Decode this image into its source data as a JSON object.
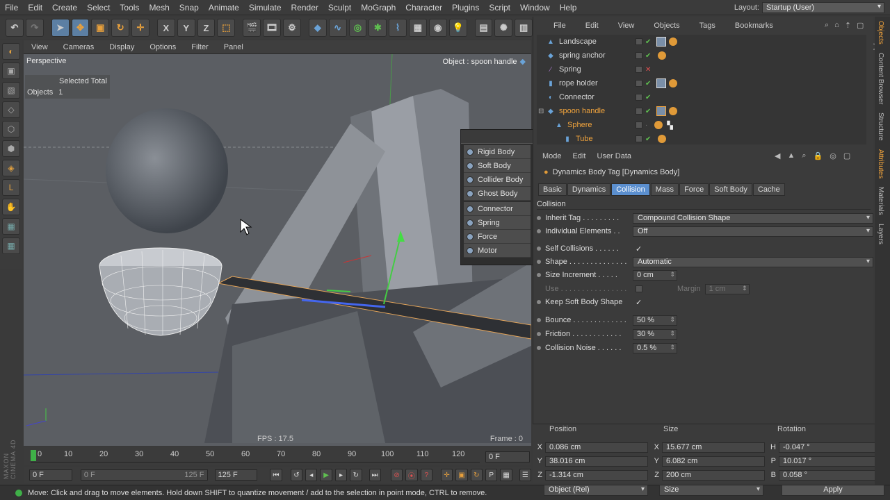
{
  "menu": [
    "File",
    "Edit",
    "Create",
    "Select",
    "Tools",
    "Mesh",
    "Snap",
    "Animate",
    "Simulate",
    "Render",
    "Sculpt",
    "MoGraph",
    "Character",
    "Plugins",
    "Script",
    "Window",
    "Help"
  ],
  "layout": {
    "label": "Layout:",
    "value": "Startup (User)"
  },
  "toolbar": {
    "x": "X",
    "y": "Y",
    "z": "Z"
  },
  "viewport": {
    "menu": [
      "View",
      "Cameras",
      "Display",
      "Options",
      "Filter",
      "Panel"
    ],
    "name": "Perspective",
    "hud_selected": "Selected Total",
    "hud_objects_label": "Objects",
    "hud_objects_value": "1",
    "object_label": "Object : spoon handle",
    "fps": "FPS : 17.5",
    "frame": "Frame : 0"
  },
  "dynamics_menu": [
    "Rigid Body",
    "Soft Body",
    "Collider Body",
    "Ghost Body",
    "Connector",
    "Spring",
    "Force",
    "Motor"
  ],
  "objects": {
    "menu": [
      "File",
      "Edit",
      "View",
      "Objects",
      "Tags",
      "Bookmarks"
    ],
    "items": [
      {
        "name": "Landscape",
        "icon": "landscape-icon"
      },
      {
        "name": "spring anchor",
        "icon": "cube-icon"
      },
      {
        "name": "Spring",
        "icon": "spring-icon"
      },
      {
        "name": "rope holder",
        "icon": "cube-icon"
      },
      {
        "name": "Connector",
        "icon": "connector-icon"
      },
      {
        "name": "spoon handle",
        "icon": "cube-icon"
      },
      {
        "name": "Sphere",
        "icon": "sphere-icon"
      },
      {
        "name": "Tube",
        "icon": "tube-icon"
      }
    ]
  },
  "attributes": {
    "menu": [
      "Mode",
      "Edit",
      "User Data"
    ],
    "title": "Dynamics Body Tag [Dynamics Body]",
    "tabs": [
      "Basic",
      "Dynamics",
      "Collision",
      "Mass",
      "Force",
      "Soft Body",
      "Cache"
    ],
    "active_tab": "Collision",
    "section": "Collision",
    "inherit_tag": {
      "label": "Inherit Tag . . . . . . . . .",
      "value": "Compound Collision Shape"
    },
    "individual": {
      "label": "Individual Elements . .",
      "value": "Off"
    },
    "self_collisions": {
      "label": "Self Collisions . . . . . .",
      "value": "✓"
    },
    "shape": {
      "label": "Shape . . . . . . . . . . . . . .",
      "value": "Automatic"
    },
    "size_increment": {
      "label": "Size Increment . . . . .",
      "value": "0 cm"
    },
    "use": {
      "label": "Use . . . . . . . . . . . . . . . .",
      "margin_label": "Margin",
      "margin_value": "1 cm"
    },
    "keep_soft": {
      "label": "Keep Soft Body Shape",
      "value": "✓"
    },
    "bounce": {
      "label": "Bounce . . . . . . . . . . . . .",
      "value": "50 %"
    },
    "friction": {
      "label": "Friction . . . . . . . . . . . .",
      "value": "30 %"
    },
    "noise": {
      "label": "Collision Noise . . . . . .",
      "value": "0.5 %"
    }
  },
  "coords": {
    "headers": [
      "Position",
      "Size",
      "Rotation"
    ],
    "rows": [
      {
        "a": "X",
        "pos": "0.086 cm",
        "b": "X",
        "size": "15.677 cm",
        "c": "H",
        "rot": "-0.047 °"
      },
      {
        "a": "Y",
        "pos": "38.016 cm",
        "b": "Y",
        "size": "6.082 cm",
        "c": "P",
        "rot": "10.017 °"
      },
      {
        "a": "Z",
        "pos": "-1.314 cm",
        "b": "Z",
        "size": "200 cm",
        "c": "B",
        "rot": "0.058 °"
      }
    ],
    "mode": "Object (Rel)",
    "size_mode": "Size",
    "apply": "Apply"
  },
  "timeline": {
    "ticks": [
      "0",
      "10",
      "20",
      "30",
      "40",
      "50",
      "60",
      "70",
      "80",
      "90",
      "100",
      "110",
      "120"
    ],
    "current": "0 F",
    "start": "0 F",
    "range_start": "0 F",
    "range_end": "125 F",
    "end": "125 F"
  },
  "status": "Move: Click and drag to move elements. Hold down SHIFT to quantize movement / add to the selection in point mode, CTRL to remove.",
  "side_tabs": [
    "Objects",
    "Content Browser",
    "Structure",
    "Attributes",
    "Materials",
    "Layers"
  ],
  "maxon": "MAXON CINEMA 4D"
}
